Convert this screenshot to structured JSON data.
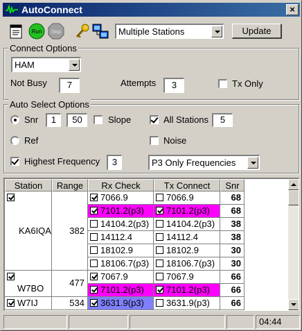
{
  "window": {
    "title": "AutoConnect",
    "close_label": "×"
  },
  "toolbar": {
    "icons": [
      "clipboard-icon",
      "run-icon",
      "stop-icon",
      "key-icon",
      "network-icon"
    ],
    "run_label": "Run",
    "stop_label": "Stop",
    "mode_select": "Multiple Stations",
    "update_label": "Update"
  },
  "connect_options": {
    "title": "Connect Options",
    "mode_select": "HAM",
    "not_busy_label": "Not Busy",
    "not_busy_value": "7",
    "attempts_label": "Attempts",
    "attempts_value": "3",
    "tx_only_label": "Tx Only",
    "tx_only_checked": false
  },
  "auto_select": {
    "title": "Auto Select Options",
    "snr_label": "Snr",
    "snr_selected": true,
    "snr_min": "1",
    "snr_max": "50",
    "slope_label": "Slope",
    "slope_checked": false,
    "all_stations_label": "All Stations",
    "all_stations_checked": true,
    "all_stations_value": "5",
    "ref_label": "Ref",
    "ref_selected": false,
    "noise_label": "Noise",
    "noise_checked": false,
    "highest_freq_label": "Highest Frequency",
    "highest_freq_checked": true,
    "highest_freq_value": "3",
    "freq_filter_select": "P3 Only Frequencies"
  },
  "grid": {
    "headers": {
      "station": "Station",
      "range": "Range",
      "rx": "Rx Check",
      "tx": "Tx Connect",
      "snr": "Snr"
    },
    "stations": [
      {
        "name": "KA6IQA",
        "range": "382",
        "checked": true,
        "rows": [
          {
            "rx": "7066.9",
            "rx_checked": true,
            "rx_color": "",
            "tx": "7066.9",
            "tx_checked": false,
            "tx_color": "",
            "snr": "68"
          },
          {
            "rx": "7101.2(p3)",
            "rx_checked": true,
            "rx_color": "magenta",
            "tx": "7101.2(p3)",
            "tx_checked": true,
            "tx_color": "magenta",
            "snr": "68"
          },
          {
            "rx": "14104.2(p3)",
            "rx_checked": false,
            "rx_color": "",
            "tx": "14104.2(p3)",
            "tx_checked": false,
            "tx_color": "",
            "snr": "38"
          },
          {
            "rx": "14112.4",
            "rx_checked": false,
            "rx_color": "",
            "tx": "14112.4",
            "tx_checked": false,
            "tx_color": "",
            "snr": "38"
          },
          {
            "rx": "18102.9",
            "rx_checked": false,
            "rx_color": "",
            "tx": "18102.9",
            "tx_checked": false,
            "tx_color": "",
            "snr": "30"
          },
          {
            "rx": "18106.7(p3)",
            "rx_checked": false,
            "rx_color": "",
            "tx": "18106.7(p3)",
            "tx_checked": false,
            "tx_color": "",
            "snr": "30"
          }
        ]
      },
      {
        "name": "W7BO",
        "range": "477",
        "checked": true,
        "rows": [
          {
            "rx": "7067.9",
            "rx_checked": true,
            "rx_color": "",
            "tx": "7067.9",
            "tx_checked": false,
            "tx_color": "",
            "snr": "66"
          },
          {
            "rx": "7101.2(p3)",
            "rx_checked": true,
            "rx_color": "magenta",
            "tx": "7101.2(p3)",
            "tx_checked": true,
            "tx_color": "magenta",
            "snr": "66"
          }
        ]
      },
      {
        "name": "W7IJ",
        "range": "534",
        "checked": true,
        "rows": [
          {
            "rx": "3631.9(p3)",
            "rx_checked": true,
            "rx_color": "blue",
            "tx": "3631.9(p3)",
            "tx_checked": false,
            "tx_color": "",
            "snr": "66"
          }
        ]
      }
    ]
  },
  "status": {
    "time": "04:44"
  },
  "colors": {
    "title_start": "#0a246a",
    "title_end": "#3a6ea5",
    "highlight_magenta": "#ff00ff",
    "highlight_blue": "#8080ff"
  }
}
